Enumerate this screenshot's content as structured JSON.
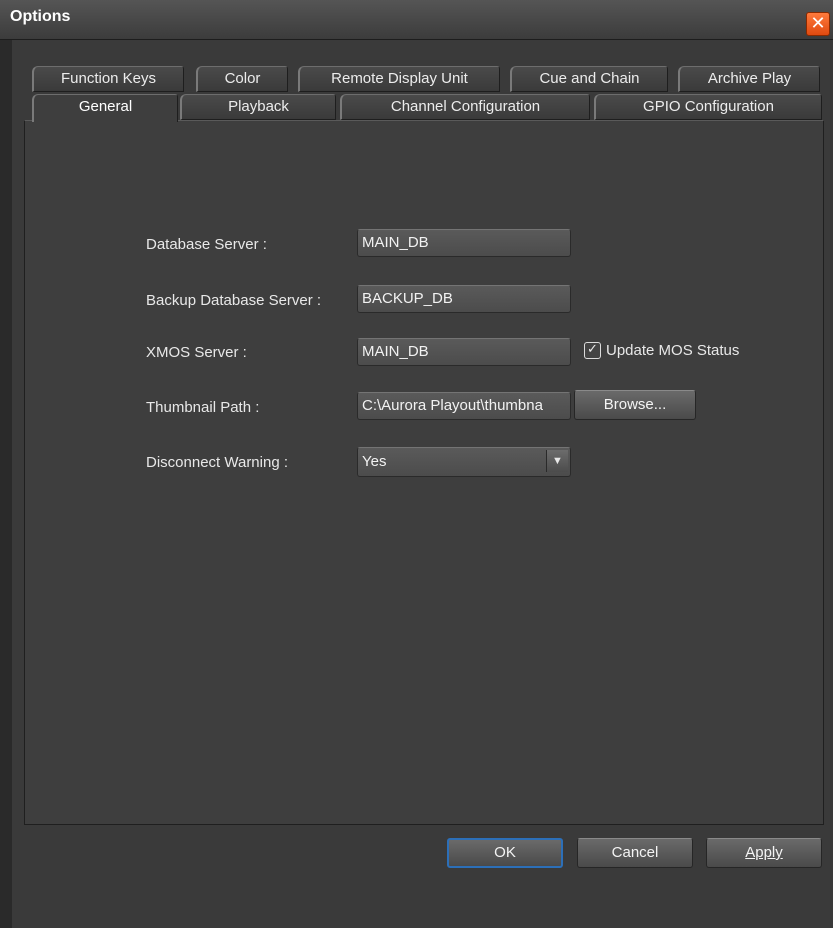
{
  "window": {
    "title": "Options",
    "close_symbol": "✕"
  },
  "tabs_back_row": [
    {
      "label": "Function Keys"
    },
    {
      "label": "Color"
    },
    {
      "label": "Remote Display Unit"
    },
    {
      "label": "Cue and Chain"
    },
    {
      "label": "Archive Play"
    }
  ],
  "tabs_front_row": [
    {
      "label": "General",
      "active": true
    },
    {
      "label": "Playback"
    },
    {
      "label": "Channel Configuration"
    },
    {
      "label": "GPIO Configuration"
    }
  ],
  "general": {
    "database_server_label": "Database Server :",
    "database_server_value": "MAIN_DB",
    "backup_db_label": "Backup Database Server :",
    "backup_db_value": "BACKUP_DB",
    "xmos_label": "XMOS Server :",
    "xmos_value": "MAIN_DB",
    "update_mos_label": "Update MOS Status",
    "update_mos_checked": true,
    "checkmark": "✓",
    "thumbnail_label": "Thumbnail Path :",
    "thumbnail_value": "C:\\Aurora Playout\\thumbna",
    "browse_label": "Browse...",
    "disconnect_label": "Disconnect Warning :",
    "disconnect_value": "Yes",
    "dropdown_symbol": "▼"
  },
  "footer": {
    "ok_label": "OK",
    "cancel_label": "Cancel",
    "apply_label": "Apply"
  }
}
